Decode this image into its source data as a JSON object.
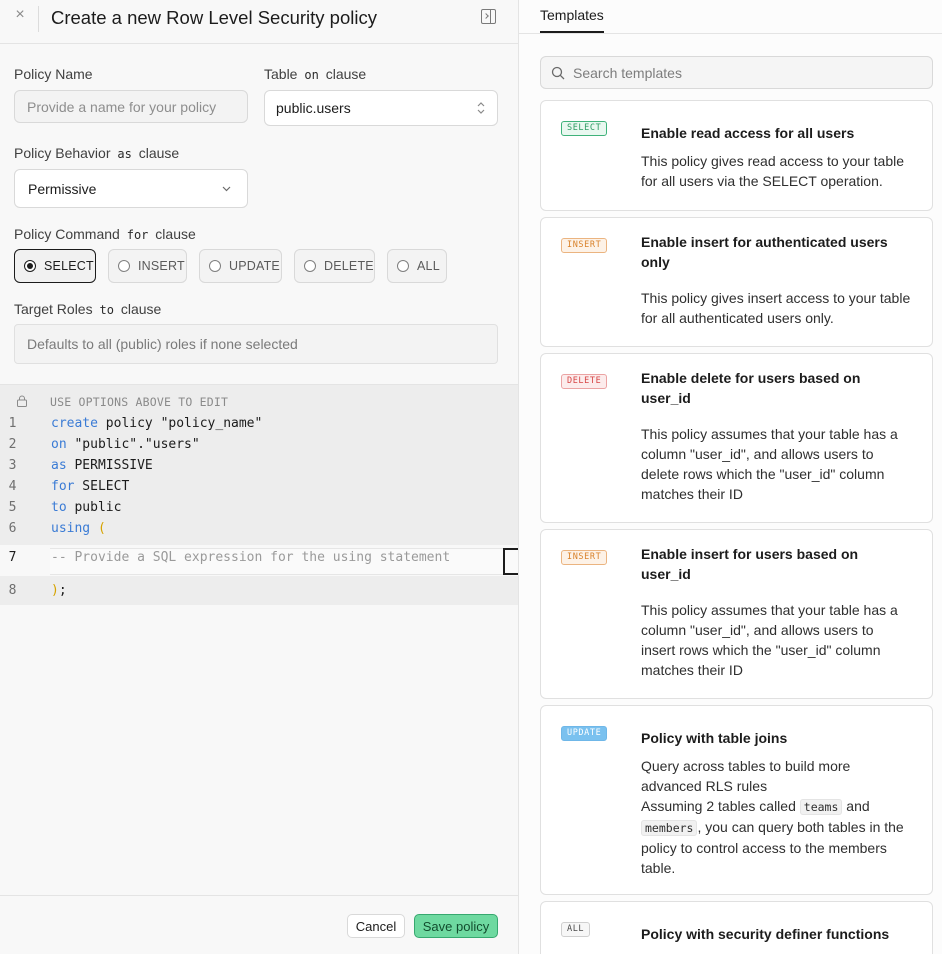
{
  "header": {
    "title": "Create a new Row Level Security policy",
    "close_glyph": "×"
  },
  "form": {
    "policy_name": {
      "label": "Policy Name",
      "placeholder": "Provide a name for your policy",
      "value": ""
    },
    "table": {
      "label": "Table",
      "clause": "on",
      "clause_suffix": "clause",
      "value": "public.users"
    },
    "behavior": {
      "label": "Policy Behavior",
      "clause": "as",
      "clause_suffix": "clause",
      "value": "Permissive"
    },
    "command": {
      "label": "Policy Command",
      "clause": "for",
      "clause_suffix": "clause",
      "options": [
        "SELECT",
        "INSERT",
        "UPDATE",
        "DELETE",
        "ALL"
      ],
      "selected": "SELECT"
    },
    "roles": {
      "label": "Target Roles",
      "clause": "to",
      "clause_suffix": "clause",
      "placeholder": "Defaults to all (public) roles if none selected"
    }
  },
  "editor": {
    "note": "USE OPTIONS ABOVE TO EDIT",
    "line_numbers": [
      "1",
      "2",
      "3",
      "4",
      "5",
      "6",
      "7",
      "8"
    ],
    "lines": {
      "l1_kw": "create",
      "l1_rest": " policy \"policy_name\"",
      "l2_kw": "on",
      "l2_rest": " \"public\".\"users\"",
      "l3_kw": "as",
      "l3_rest": " PERMISSIVE",
      "l4_kw": "for",
      "l4_rest": " SELECT",
      "l5_kw": "to",
      "l5_rest": " public",
      "l6_kw": "using",
      "l6_paren": " (",
      "l7": "-- Provide a SQL expression for the using statement",
      "l8_paren": ")",
      "l8_rest": ";"
    }
  },
  "footer": {
    "cancel_label": "Cancel",
    "save_label": "Save policy"
  },
  "templates_panel": {
    "tab_label": "Templates",
    "search_placeholder": "Search templates",
    "cards": [
      {
        "badge": "SELECT",
        "title": "Enable read access for all users",
        "description": "This policy gives read access to your table for all users via the SELECT operation."
      },
      {
        "badge": "INSERT",
        "title": "Enable insert for authenticated users only",
        "description": "This policy gives insert access to your table for all authenticated users only."
      },
      {
        "badge": "DELETE",
        "title": "Enable delete for users based on user_id",
        "description": "This policy assumes that your table has a column \"user_id\", and allows users to delete rows which the \"user_id\" column matches their ID"
      },
      {
        "badge": "INSERT",
        "title": "Enable insert for users based on user_id",
        "description": "This policy assumes that your table has a column \"user_id\", and allows users to insert rows which the \"user_id\" column matches their ID"
      },
      {
        "badge": "UPDATE",
        "title": "Policy with table joins",
        "description_1": "Query across tables to build more advanced RLS rules",
        "description_2a": "Assuming 2 tables called ",
        "code_1": "teams",
        "description_2b": " and ",
        "code_2": "members",
        "description_2c": ", you can query both tables in the policy to control access to the members table."
      },
      {
        "badge": "ALL",
        "title": "Policy with security definer functions"
      }
    ]
  },
  "colors": {
    "save_button": "#6ed9a0",
    "select_badge": "#3fb27a",
    "insert_badge": "#d9822b",
    "delete_badge": "#d64545",
    "update_badge": "#7ac1ef",
    "sql_keyword": "#3a7bd5"
  },
  "icons": {
    "close": "close-icon",
    "collapse": "sidebar-collapse-icon",
    "table_select": "chevron-up-down-icon",
    "behavior_select": "chevron-down-icon",
    "editor_lock": "lock-icon",
    "search": "search-icon"
  }
}
